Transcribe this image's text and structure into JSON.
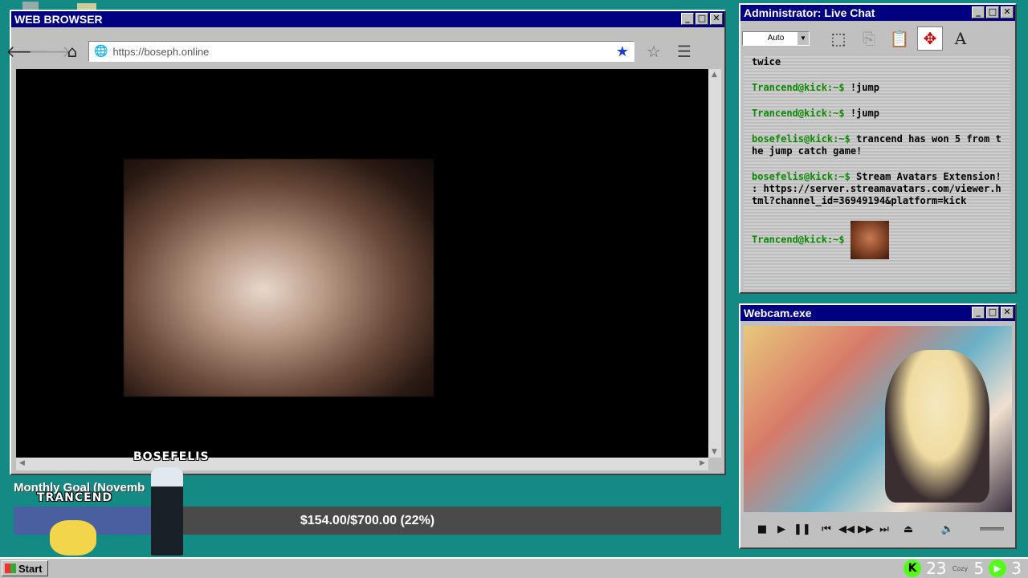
{
  "browser": {
    "title": "WEB BROWSER",
    "url": "https://boseph.online",
    "buttons": {
      "minimize": "_",
      "maximize": "□",
      "close": "✕"
    }
  },
  "chat": {
    "title": "Administrator: Live Chat",
    "zoom_select": "Auto",
    "messages": [
      {
        "user": "",
        "text": "twice"
      },
      {
        "user": "Trancend@kick:~$",
        "text": "!jump"
      },
      {
        "user": "Trancend@kick:~$",
        "text": "!jump"
      },
      {
        "user": "bosefelis@kick:~$",
        "text": "trancend has won 5 from the jump catch game!"
      },
      {
        "user": "bosefelis@kick:~$",
        "text": "Stream Avatars Extension! : https://server.streamavatars.com/viewer.html?channel_id=36949194&platform=kick"
      },
      {
        "user": "Trancend@kick:~$",
        "text": ""
      }
    ]
  },
  "webcam": {
    "title": "Webcam.exe"
  },
  "goal": {
    "title": "Monthly Goal (Novemb",
    "amount_text": "$154.00/$700.00 (22%)",
    "progress": 0.22
  },
  "avatars": {
    "name1": "BOSEFELIS",
    "name2": "TRANCEND"
  },
  "taskbar": {
    "start_label": "Start",
    "tray_count_a": "23",
    "tray_cozy": "Cozy",
    "tray_count_b": "5",
    "tray_count_c": "3"
  },
  "colors": {
    "desktop": "#148a84",
    "titlebar": "#000080",
    "kick_green": "#53fc18",
    "chat_user": "#0a8a00"
  }
}
